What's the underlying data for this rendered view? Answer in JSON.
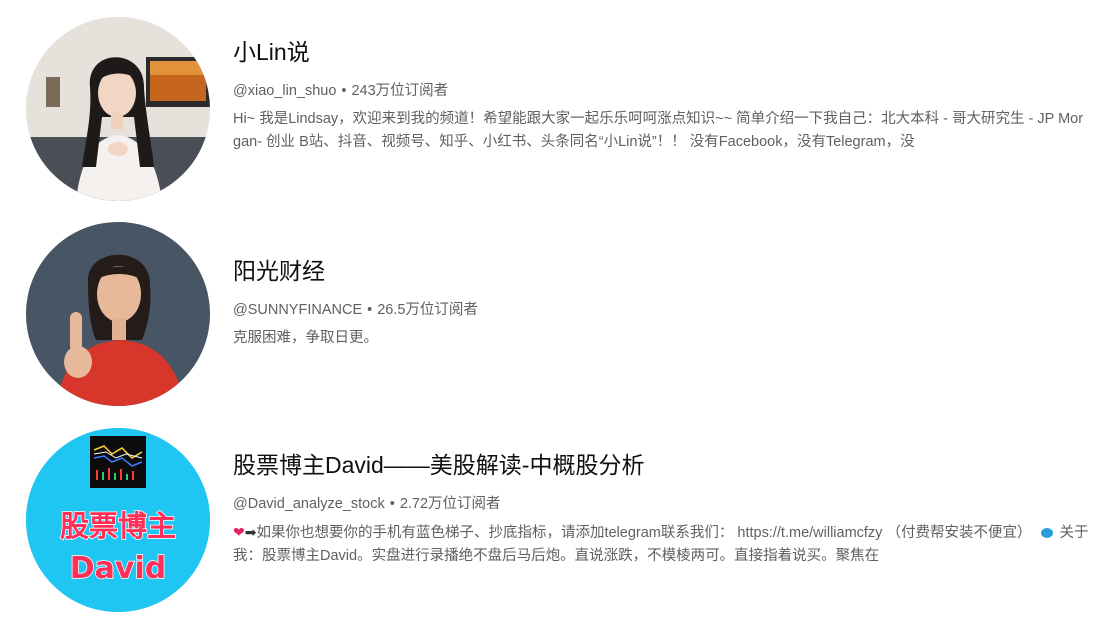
{
  "channels": [
    {
      "name": "小Lin说",
      "handle": "@xiao_lin_shuo",
      "subscribers": "243万位订阅者",
      "description": "Hi~ 我是Lindsay，欢迎来到我的频道！希望能跟大家一起乐乐呵呵涨点知识~~ 简单介绍一下我自己：北大本科 - 哥大研究生 - JP Morgan- 创业 B站、抖音、视频号、知乎、小红书、头条同名“小Lin说”！！ 没有Facebook，没有Telegram，没"
    },
    {
      "name": "阳光财经",
      "handle": "@SUNNYFINANCE",
      "subscribers": "26.5万位订阅者",
      "description": "克服困难，争取日更。"
    },
    {
      "name": "股票博主David——美股解读-中概股分析",
      "handle": "@David_analyze_stock",
      "subscribers": "2.72万位订阅者",
      "description_part1": "如果你也想要你的手机有蓝色梯子、抄底指标，请添加telegram联系我们： https://t.me/williamcfzy （付费帮安装不便宜）",
      "description_part2": "关于我：股票博主David。实盘进行录播绝不盘后马后炮。直说涨跌，不模棱两可。直接指着说买。聚焦在",
      "avatar_text_line1": "股票博主",
      "avatar_text_line2": "David"
    }
  ],
  "separator": "•",
  "icons": [
    "red-heart-emoji-icon",
    "right-arrow-emoji-icon",
    "speech-bubble-emoji-icon"
  ]
}
